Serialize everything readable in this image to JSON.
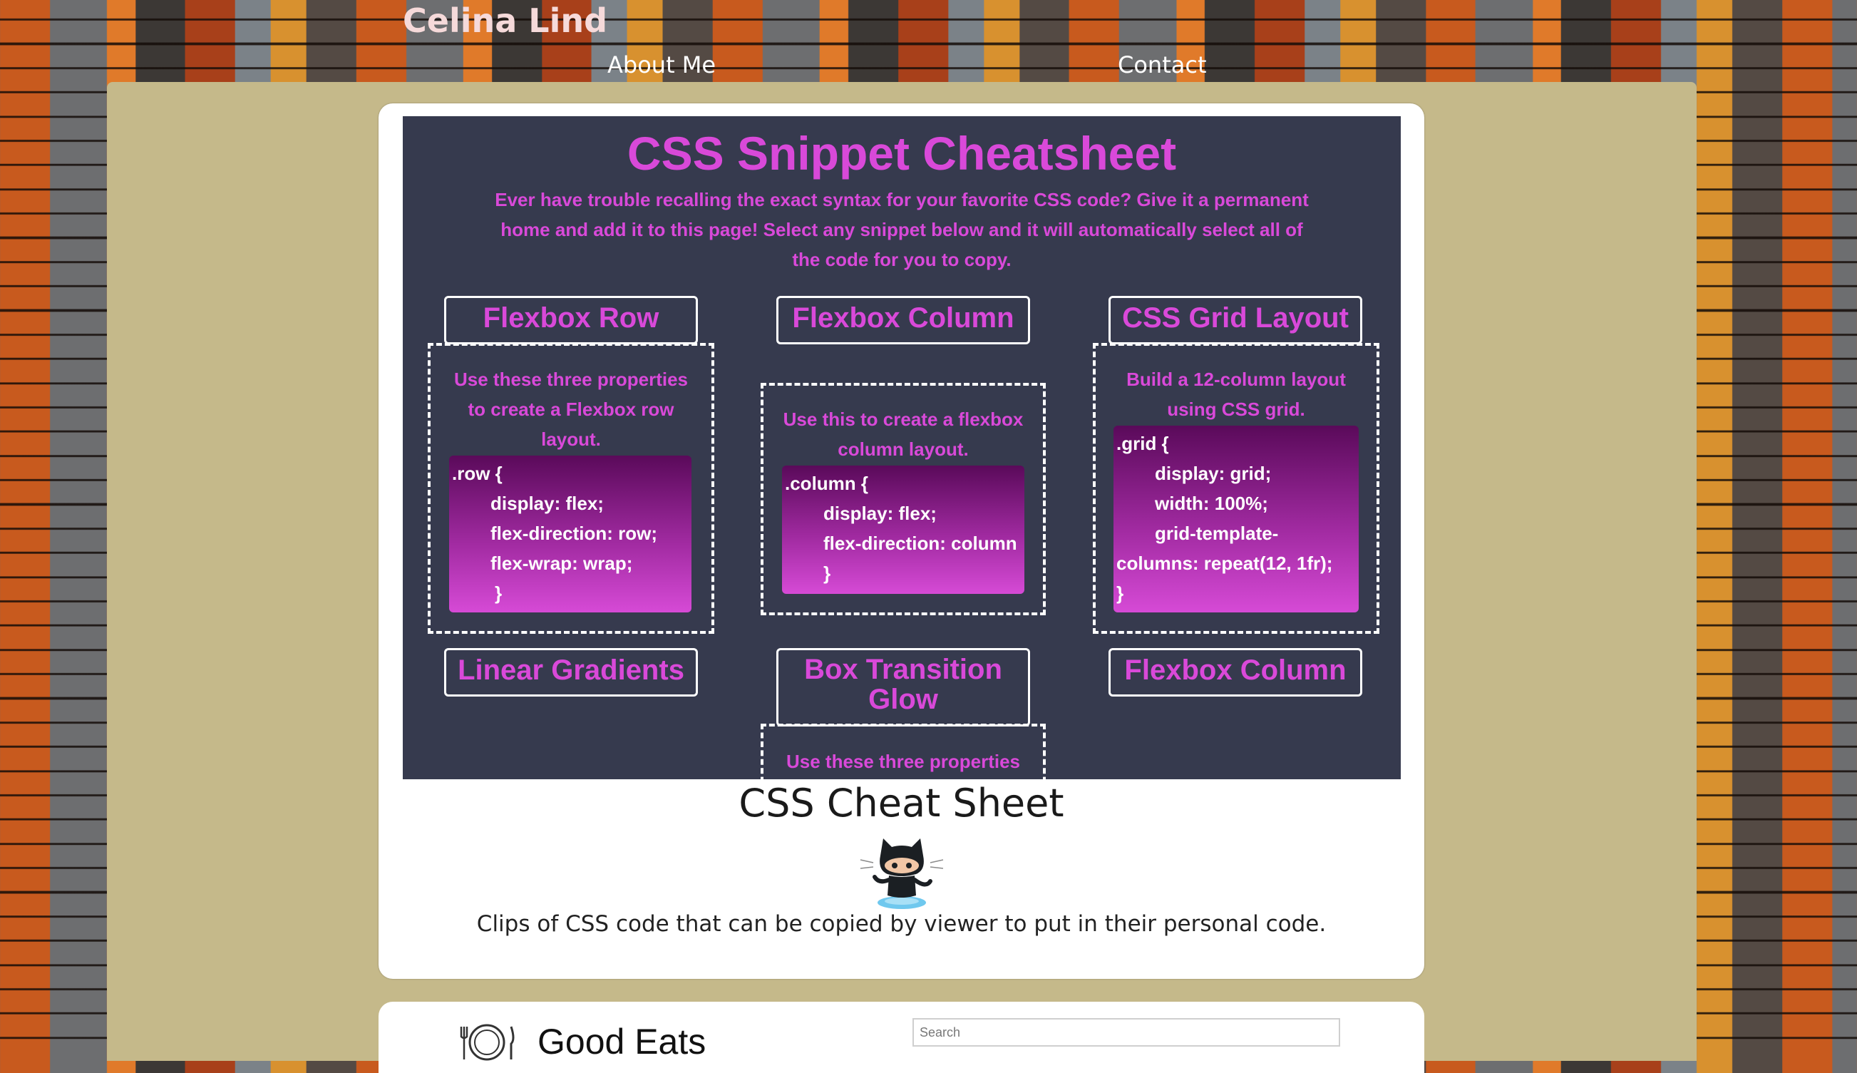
{
  "header": {
    "brand": "Celina Lind",
    "nav": [
      {
        "label": "About Me"
      },
      {
        "label": "Contact"
      }
    ]
  },
  "project": {
    "preview": {
      "title": "CSS Snippet Cheatsheet",
      "description": "Ever have trouble recalling the exact syntax for your favorite CSS code? Give it a permanent home and add it to this page! Select any snippet below and it will automatically select all of the code for you to copy.",
      "snippets": [
        {
          "title": "Flexbox Row",
          "description": "Use these three properties to create a Flexbox row layout.",
          "code": [
            ".row {",
            "display: flex;",
            "flex-direction: row;",
            "flex-wrap: wrap;",
            "}"
          ]
        },
        {
          "title": "Flexbox Column",
          "description": "Use this to create a flexbox column layout.",
          "code": [
            ".column {",
            "display: flex;",
            "flex-direction: column",
            "}"
          ]
        },
        {
          "title": "CSS Grid Layout",
          "description": "Build a 12-column layout using CSS grid.",
          "code": [
            ".grid {",
            "display: grid;",
            "width: 100%;",
            "grid-template-",
            "columns: repeat(12, 1fr);",
            "}"
          ]
        },
        {
          "title": "Linear Gradients"
        },
        {
          "title": "Box Transition Glow",
          "description": "Use these three properties"
        },
        {
          "title": "Flexbox Column"
        }
      ]
    },
    "title": "CSS Cheat Sheet",
    "icon": "github-octocat-icon",
    "description": "Clips of CSS code that can be copied by viewer to put in their personal code."
  },
  "next_project": {
    "icon": "plate-fork-knife-icon",
    "title": "Good Eats",
    "search_placeholder": "Search"
  },
  "colors": {
    "panel": "#c5b98a",
    "preview_bg": "#363a4e",
    "accent_magenta": "#d949d9",
    "brand_text": "#f6dada"
  }
}
